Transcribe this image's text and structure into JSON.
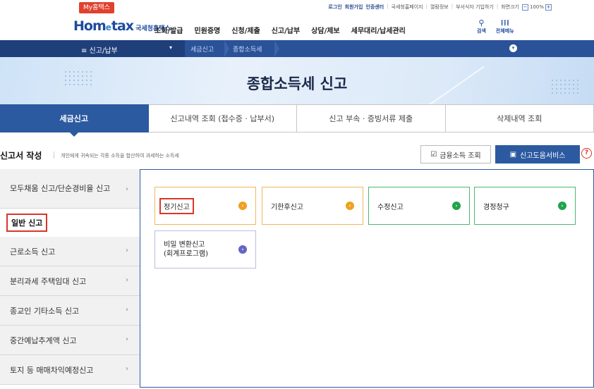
{
  "util": {
    "my_hometax": "My홈택스",
    "links": [
      "로그인",
      "회원가입",
      "인증센터",
      "국세청홈페이지",
      "열람정보",
      "부서식자 기입하기",
      "화면크기"
    ],
    "zoom_minus": "−",
    "zoom_value": "100%",
    "zoom_plus": "+"
  },
  "header": {
    "logo_home": "Hom",
    "logo_e": "e",
    "logo_tax": "tax",
    "logo_sub": "국세청홈택스",
    "gnb": [
      "조회/발급",
      "민원증명",
      "신청/제출",
      "신고/납부",
      "상담/제보",
      "세무대리/납세관리"
    ],
    "search_label": "검색",
    "allmenu_label": "전체메뉴"
  },
  "crumb": {
    "menu": "≡  신고/납부",
    "c1": "세금신고",
    "c2": "종합소득세"
  },
  "banner": {
    "title": "종합소득세 신고"
  },
  "tabs": [
    "세금신고",
    "신고내역 조회 (접수증 · 납부서)",
    "신고 부속 · 증빙서류 제출",
    "삭제내역 조회"
  ],
  "section": {
    "title": "신고서 작성",
    "desc": "개인에게 귀속되는 각종 소득을 합산하여 과세하는 소득세",
    "fin_button": "금융소득 조회",
    "help_button": "신고도움서비스",
    "help_icon": "?"
  },
  "left_menu": [
    "모두채움 신고/단순경비율 신고",
    "일반 신고",
    "근로소득 신고",
    "분리과세 주택임대 신고",
    "종교인 기타소득 신고",
    "중간예납추계액 신고",
    "토지 등 매매차익예정신고"
  ],
  "cards": {
    "c1": "정기신고",
    "c2": "기한후신고",
    "c3": "수정신고",
    "c4": "경정청구",
    "c5_line1": "비밀 변환신고",
    "c5_line2": "(회계프로그램)"
  },
  "colors": {
    "primary": "#2c5aa0",
    "highlight": "#d9362b",
    "orange": "#f0a020",
    "green": "#21a44a",
    "purple": "#6366c4"
  }
}
